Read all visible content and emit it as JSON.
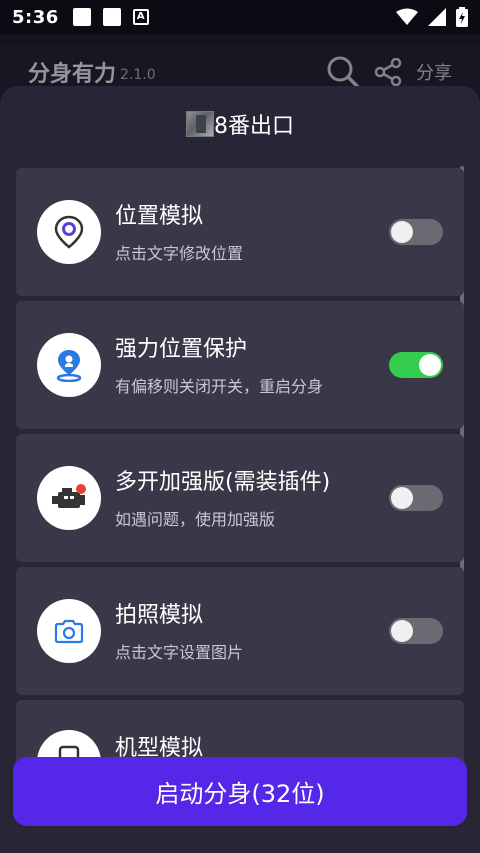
{
  "status_bar": {
    "time": "5:36",
    "a_label": "A"
  },
  "app_header": {
    "title": "分身有力",
    "version": "2.1.0",
    "share_label": "分享"
  },
  "sheet": {
    "title": "8番出口",
    "items": [
      {
        "title": "位置模拟",
        "subtitle": "点击文字修改位置",
        "toggle_on": false,
        "icon": "location-pin-icon"
      },
      {
        "title": "强力位置保护",
        "subtitle": "有偏移则关闭开关，重启分身",
        "toggle_on": true,
        "icon": "location-shield-icon"
      },
      {
        "title": "多开加强版(需装插件)",
        "subtitle": "如遇问题，使用加强版",
        "toggle_on": false,
        "icon": "engine-icon"
      },
      {
        "title": "拍照模拟",
        "subtitle": "点击文字设置图片",
        "toggle_on": false,
        "icon": "camera-icon"
      },
      {
        "title": "机型模拟",
        "icon": "phone-model-icon"
      }
    ]
  },
  "start_button": {
    "label": "启动分身(32位)"
  },
  "colors": {
    "accent": "#5527e8",
    "toggle_on": "#33cc4c",
    "card_bg": "#3a3848",
    "sheet_bg": "#272536",
    "icon_purple": "#5a3fd6",
    "icon_blue": "#2a7ae4"
  }
}
